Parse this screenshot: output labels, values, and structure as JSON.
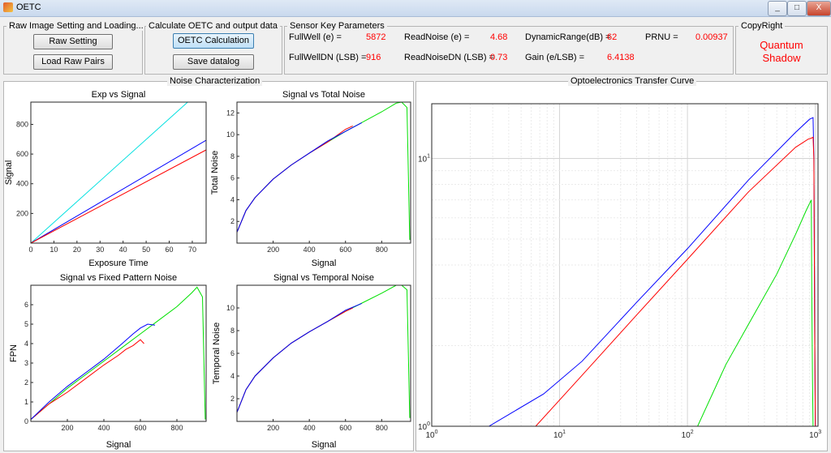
{
  "window": {
    "title": "OETC",
    "controls": [
      "_",
      "□",
      "X"
    ]
  },
  "raw_panel": {
    "title": "Raw Image Setting and Loading...",
    "raw_setting": "Raw Setting",
    "load_pairs": "Load Raw Pairs"
  },
  "calc_panel": {
    "title": "Calculate OETC and output data",
    "oetc_calc": "OETC Calculation",
    "save_datalog": "Save datalog"
  },
  "params_panel": {
    "title": "Sensor Key Parameters",
    "fullwell_label": "FullWell (e) =",
    "fullwell_value": "5872",
    "readnoise_label": "ReadNoise (e) =",
    "readnoise_value": "4.68",
    "dr_label": "DynamicRange(dB) =",
    "dr_value": "62",
    "prnu_label": "PRNU =",
    "prnu_value": "0.00937",
    "fullwelldn_label": "FullWellDN (LSB) =",
    "fullwelldn_value": "916",
    "readnoisedn_label": "ReadNoiseDN (LSB) =",
    "readnoisedn_value": "0.73",
    "gain_label": "Gain (e/LSB) =",
    "gain_value": "6.4138"
  },
  "copyright_panel": {
    "title": "CopyRight",
    "line1": "Quantum",
    "line2": "Shadow"
  },
  "noise_panel": {
    "title": "Noise Characterization"
  },
  "oetc_panel": {
    "title": "Optoelectronics Transfer Curve"
  },
  "colors": {
    "red": "#ff0000",
    "blue": "#0000ff",
    "green": "#00e000",
    "cyan": "#00e0e0"
  },
  "chart_data": [
    {
      "id": "exp_vs_signal",
      "type": "line",
      "title": "Exp vs Signal",
      "xlabel": "Exposure Time",
      "ylabel": "Signal",
      "xlim": [
        0,
        76
      ],
      "ylim": [
        0,
        950
      ],
      "xticks": [
        0,
        10,
        20,
        30,
        40,
        50,
        60,
        70
      ],
      "yticks": [
        200,
        400,
        600,
        800
      ],
      "series": [
        {
          "color": "cyan",
          "x": [
            0,
            68,
            76
          ],
          "y": [
            0,
            950,
            950
          ]
        },
        {
          "color": "blue",
          "x": [
            0,
            76
          ],
          "y": [
            0,
            693
          ]
        },
        {
          "color": "red",
          "x": [
            0,
            76
          ],
          "y": [
            0,
            628
          ]
        }
      ]
    },
    {
      "id": "signal_vs_total_noise",
      "type": "line",
      "title": "Signal vs Total Noise",
      "xlabel": "Signal",
      "ylabel": "Total Noise",
      "xlim": [
        0,
        960
      ],
      "ylim": [
        0,
        13
      ],
      "xticks": [
        200,
        400,
        600,
        800
      ],
      "yticks": [
        2,
        4,
        6,
        8,
        10,
        12
      ],
      "series": [
        {
          "color": "green",
          "x": [
            0,
            50,
            100,
            200,
            300,
            400,
            500,
            600,
            700,
            800,
            880,
            910,
            940,
            955
          ],
          "y": [
            1.0,
            3.0,
            4.2,
            5.9,
            7.2,
            8.3,
            9.3,
            10.3,
            11.2,
            12.1,
            12.9,
            13.0,
            12.5,
            0.3
          ]
        },
        {
          "color": "red",
          "x": [
            0,
            50,
            100,
            200,
            300,
            400,
            500,
            600,
            640
          ],
          "y": [
            1.0,
            3.0,
            4.2,
            5.9,
            7.2,
            8.3,
            9.3,
            10.5,
            10.8
          ]
        },
        {
          "color": "blue",
          "x": [
            0,
            50,
            100,
            200,
            300,
            400,
            500,
            600,
            690
          ],
          "y": [
            1.0,
            3.0,
            4.2,
            5.9,
            7.2,
            8.3,
            9.4,
            10.3,
            11.1
          ]
        }
      ]
    },
    {
      "id": "signal_vs_fpn",
      "type": "line",
      "title": "Signal vs Fixed Pattern Noise",
      "xlabel": "Signal",
      "ylabel": "FPN",
      "xlim": [
        0,
        960
      ],
      "ylim": [
        0,
        7
      ],
      "xticks": [
        200,
        400,
        600,
        800
      ],
      "yticks": [
        0,
        1,
        2,
        3,
        4,
        5,
        6
      ],
      "series": [
        {
          "color": "green",
          "x": [
            0,
            100,
            200,
            300,
            400,
            500,
            600,
            700,
            800,
            880,
            910,
            940,
            955
          ],
          "y": [
            0.1,
            0.9,
            1.7,
            2.4,
            3.1,
            3.8,
            4.5,
            5.2,
            5.9,
            6.6,
            6.9,
            6.4,
            0.1
          ]
        },
        {
          "color": "red",
          "x": [
            0,
            100,
            200,
            300,
            400,
            480,
            520,
            560,
            600,
            620
          ],
          "y": [
            0.1,
            0.9,
            1.5,
            2.2,
            2.9,
            3.4,
            3.7,
            3.9,
            4.2,
            4.0
          ]
        },
        {
          "color": "blue",
          "x": [
            0,
            100,
            200,
            300,
            400,
            500,
            560,
            600,
            640,
            680
          ],
          "y": [
            0.1,
            1.0,
            1.8,
            2.5,
            3.2,
            4.0,
            4.5,
            4.8,
            5.0,
            4.95
          ]
        }
      ]
    },
    {
      "id": "signal_vs_temporal_noise",
      "type": "line",
      "title": "Signal vs Temporal Noise",
      "xlabel": "Signal",
      "ylabel": "Temporal Noise",
      "xlim": [
        0,
        960
      ],
      "ylim": [
        0,
        12
      ],
      "xticks": [
        200,
        400,
        600,
        800
      ],
      "yticks": [
        2,
        4,
        6,
        8,
        10
      ],
      "series": [
        {
          "color": "green",
          "x": [
            0,
            50,
            100,
            200,
            300,
            400,
            500,
            600,
            700,
            800,
            880,
            910,
            940,
            955
          ],
          "y": [
            0.8,
            2.8,
            4.0,
            5.6,
            6.9,
            7.9,
            8.8,
            9.7,
            10.5,
            11.3,
            12.0,
            12.0,
            11.6,
            0.3
          ]
        },
        {
          "color": "red",
          "x": [
            0,
            50,
            100,
            200,
            300,
            400,
            500,
            600,
            640
          ],
          "y": [
            0.8,
            2.8,
            4.0,
            5.6,
            6.9,
            7.9,
            8.8,
            9.7,
            10.0
          ]
        },
        {
          "color": "blue",
          "x": [
            0,
            50,
            100,
            200,
            300,
            400,
            500,
            600,
            690
          ],
          "y": [
            0.8,
            2.8,
            4.0,
            5.6,
            6.9,
            7.9,
            8.8,
            9.8,
            10.4
          ]
        }
      ]
    },
    {
      "id": "oetc",
      "type": "line",
      "title": "",
      "xlabel": "",
      "ylabel": "",
      "xscale": "log",
      "yscale": "log",
      "xlim": [
        1,
        1050
      ],
      "ylim": [
        1,
        16
      ],
      "xtick_labels": [
        {
          "v": 1,
          "t": "10",
          "e": "0"
        },
        {
          "v": 10,
          "t": "10",
          "e": "1"
        },
        {
          "v": 100,
          "t": "10",
          "e": "2"
        },
        {
          "v": 1000,
          "t": "10",
          "e": "3"
        }
      ],
      "ytick_labels": [
        {
          "v": 1,
          "t": "10",
          "e": "0"
        },
        {
          "v": 10,
          "t": "10",
          "e": "1"
        }
      ],
      "grid": true,
      "series": [
        {
          "color": "blue",
          "x": [
            2.8,
            7.5,
            15,
            40,
            100,
            300,
            700,
            900,
            960,
            975,
            990,
            1000
          ],
          "y": [
            1.0,
            1.32,
            1.75,
            2.9,
            4.6,
            8.3,
            12.5,
            14.0,
            14.2,
            10,
            2,
            1
          ]
        },
        {
          "color": "red",
          "x": [
            6.5,
            15,
            40,
            100,
            300,
            700,
            880,
            930,
            960,
            975,
            990,
            1000
          ],
          "y": [
            1.0,
            1.55,
            2.6,
            4.2,
            7.5,
            11.0,
            11.8,
            11.9,
            12.0,
            10,
            2,
            1
          ]
        },
        {
          "color": "green",
          "x": [
            120,
            200,
            300,
            500,
            700,
            850,
            930,
            940,
            950,
            960
          ],
          "y": [
            1.0,
            1.7,
            2.4,
            3.7,
            5.2,
            6.4,
            7.0,
            3.0,
            1.5,
            1.0
          ]
        }
      ]
    }
  ]
}
